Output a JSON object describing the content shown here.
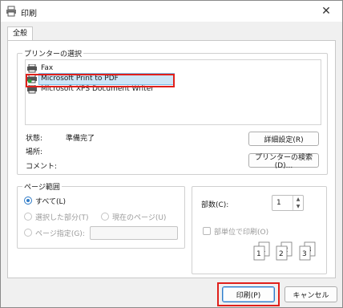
{
  "window": {
    "title": "印刷",
    "close_glyph": "✕"
  },
  "tab": {
    "label": "全般"
  },
  "printer_group": {
    "label": "プリンターの選択",
    "printers": [
      {
        "name": "Fax",
        "selected": false
      },
      {
        "name": "Microsoft Print to PDF",
        "selected": true
      },
      {
        "name": "Microsoft XPS Document Writer",
        "selected": false
      }
    ]
  },
  "status": {
    "status_label": "状態:",
    "status_value": "準備完了",
    "location_label": "場所:",
    "comment_label": "コメント:"
  },
  "buttons": {
    "preferences": "詳細設定(R)",
    "find_printer": "プリンターの検索(D)...",
    "print": "印刷(P)",
    "cancel": "キャンセル"
  },
  "page_range": {
    "label": "ページ範囲",
    "all": "すべて(L)",
    "selection": "選択した部分(T)",
    "current_page": "現在のページ(U)",
    "pages": "ページ指定(G):",
    "selected_option": "all"
  },
  "copies": {
    "label": "部数(C):",
    "value": "1",
    "collate_label": "部単位で印刷(O)",
    "collate_checked": false,
    "collate_pages": [
      "1",
      "1",
      "2",
      "2",
      "3",
      "3"
    ]
  },
  "colors": {
    "accent": "#2f7bc7",
    "highlight_box": "#e0201b",
    "selection_bg": "#cde6f7"
  }
}
